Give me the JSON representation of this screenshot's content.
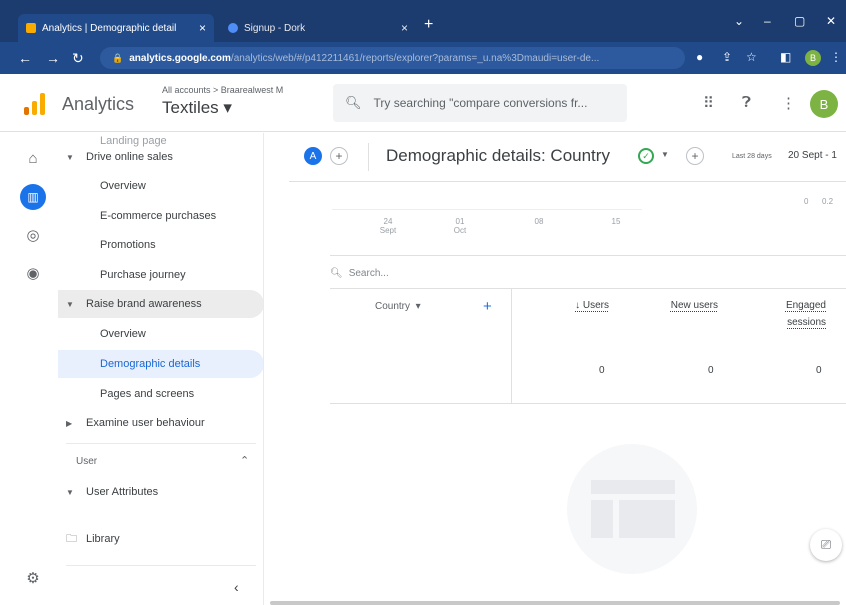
{
  "browser": {
    "tabs": [
      {
        "title": "Analytics | Demographic detail",
        "active": true,
        "favicon_color": "#f9ab00"
      },
      {
        "title": "Signup - Dork",
        "active": false,
        "favicon_color": "#4f8ef7"
      }
    ],
    "new_tab_label": "+",
    "url_host": "analytics.google.com",
    "url_path": "/analytics/web/#/p412211461/reports/explorer?params=_u.na%3Dmaudi=user-de...",
    "window_controls": [
      "⌄",
      "–",
      "▢",
      "✕"
    ],
    "profile_initial": "B"
  },
  "header": {
    "app_name": "Analytics",
    "account_path": "All accounts > Braarealwest M",
    "property": "Textiles ▾",
    "search_placeholder": "Try searching \"compare conversions fr...",
    "avatar_initial": "B"
  },
  "sidebar": {
    "cutoff_item": "Landing page",
    "groups": [
      {
        "label": "Drive online sales",
        "expanded": true,
        "items": [
          "Overview",
          "E-commerce purchases",
          "Promotions",
          "Purchase journey"
        ]
      },
      {
        "label": "Raise brand awareness",
        "expanded": true,
        "items": [
          "Overview",
          "Demographic details",
          "Pages and screens"
        ]
      },
      {
        "label": "Examine user behaviour",
        "expanded": false,
        "items": []
      }
    ],
    "user_section_label": "User",
    "user_attributes_label": "User Attributes",
    "library_label": "Library",
    "collapse_label": "‹"
  },
  "report": {
    "comparison_badge": "A",
    "title": "Demographic details: Country",
    "date_label": "Last 28 days",
    "date_range": "20 Sept - 1",
    "axis_ticks": [
      {
        "day": "24",
        "month": "Sept"
      },
      {
        "day": "01",
        "month": "Oct"
      },
      {
        "day": "08",
        "month": ""
      },
      {
        "day": "15",
        "month": ""
      }
    ],
    "y_ticks": [
      "0",
      "0.2"
    ],
    "table_search_placeholder": "Search...",
    "dimension_header": "Country",
    "columns": [
      {
        "label_1": "↓ Users",
        "label_2": "",
        "value": "0"
      },
      {
        "label_1": "New users",
        "label_2": "",
        "value": "0"
      },
      {
        "label_1": "Engaged",
        "label_2": "sessions",
        "value": "0"
      }
    ]
  },
  "colors": {
    "tab_bar": "#1c3b6e",
    "address_bar": "#214a8a",
    "accent": "#1a73e8",
    "selected_nav_bg": "#e8f0fe",
    "success": "#34a853"
  },
  "icons": {
    "rail": [
      "home-icon",
      "reports-icon",
      "explore-icon",
      "advertising-icon"
    ],
    "settings": "gear-icon"
  }
}
